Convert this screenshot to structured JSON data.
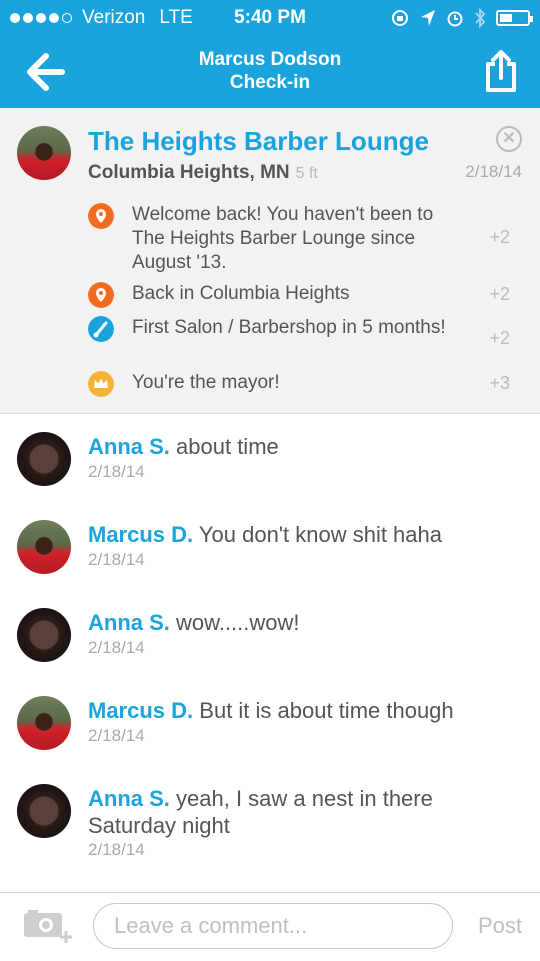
{
  "status_bar": {
    "carrier": "Verizon",
    "network": "LTE",
    "time": "5:40 PM"
  },
  "nav": {
    "title_line1": "Marcus Dodson",
    "title_line2": "Check-in"
  },
  "checkin": {
    "venue": "The Heights Barber Lounge",
    "location": "Columbia Heights, MN",
    "distance": "5 ft",
    "date": "2/18/14",
    "bonuses": [
      {
        "text": "Welcome back! You haven't been to The Heights Barber Lounge since August '13.",
        "points": "+2",
        "icon": "location-pin-icon",
        "color": "#f26b21"
      },
      {
        "text": "Back in Columbia Heights",
        "points": "+2",
        "icon": "location-pin-icon",
        "color": "#f26b21"
      },
      {
        "text": "First Salon / Barbershop in 5 months!",
        "points": "+2",
        "icon": "scissors-icon",
        "color": "#1aa3dd"
      },
      {
        "text": "You're the mayor!",
        "points": "+3",
        "icon": "crown-icon",
        "color": "#f5b335"
      }
    ]
  },
  "comments": [
    {
      "author": "Anna S.",
      "text": "about time",
      "date": "2/18/14"
    },
    {
      "author": "Marcus D.",
      "text": "You don't know shit haha",
      "date": "2/18/14"
    },
    {
      "author": "Anna S.",
      "text": "wow.....wow!",
      "date": "2/18/14"
    },
    {
      "author": "Marcus D.",
      "text": "But it is about time though",
      "date": "2/18/14"
    },
    {
      "author": "Anna S.",
      "text": "yeah, I saw a nest in there Saturday night",
      "date": "2/18/14"
    }
  ],
  "composer": {
    "placeholder": "Leave a comment...",
    "post_label": "Post"
  },
  "colors": {
    "accent": "#1aa3dd",
    "orange": "#f26b21",
    "gold": "#f5b335"
  }
}
